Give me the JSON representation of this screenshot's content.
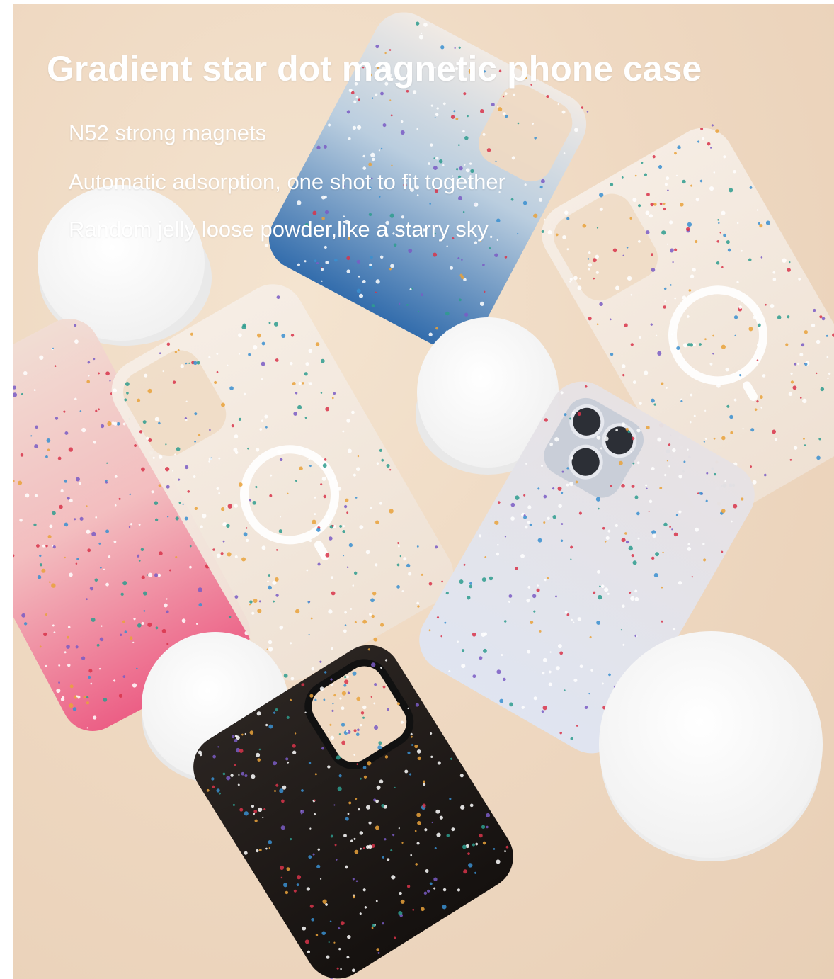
{
  "headline": "Gradient star dot magnetic phone case",
  "features": [
    "N52 strong magnets",
    "Automatic adsorption, one shot to fit together",
    "Random jelly loose powder,like a starry sky"
  ],
  "colors": {
    "background": "#efd9c2",
    "text": "#ffffff",
    "case_blue": "#2f6fb0",
    "case_pink": "#ec5a83",
    "case_clear": "#f3e8dc",
    "case_black": "#1f1917",
    "case_lilac": "#dfe3ef",
    "pedestal": "#fbfbfb"
  }
}
